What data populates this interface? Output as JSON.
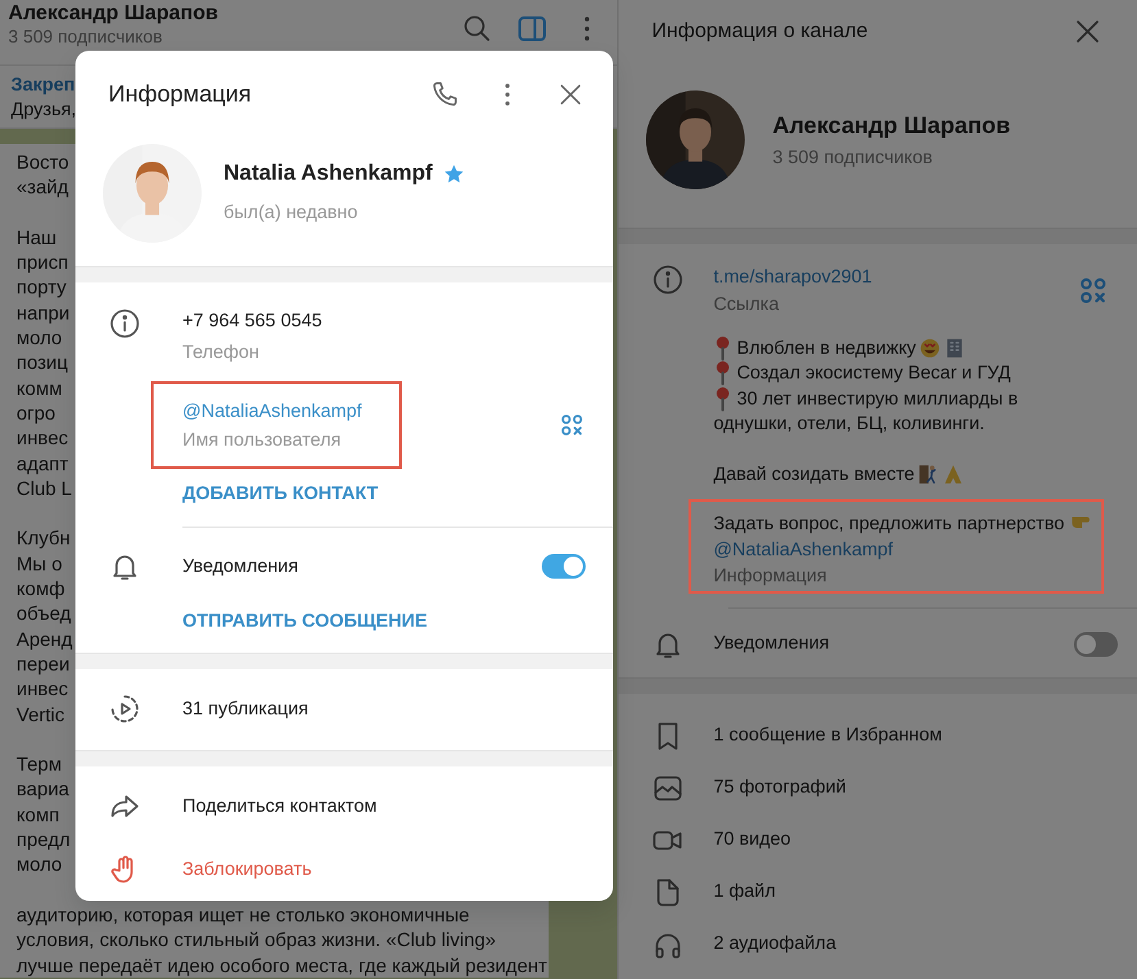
{
  "chat": {
    "title": "Александр Шарапов",
    "subtitle": "3 509 подписчиков",
    "pinned": {
      "label": "Закреп",
      "text": "Друзья,"
    },
    "message_paragraphs": [
      [
        "Восто",
        "«зайд"
      ],
      [
        "Наш",
        "присп",
        "порту",
        "напри",
        "моло",
        "позиц",
        "комм",
        "огро",
        "инвес",
        "адапт",
        "Club L"
      ],
      [
        "Клубн",
        "Мы о",
        "комф",
        "объед",
        "Аренд",
        "переи",
        "инвес",
        "Vertic"
      ],
      [
        "Терм",
        "вариа",
        "комп",
        "предл",
        "моло"
      ],
      [
        "аудиторию, которая ищет не столько экономичные",
        "условия, сколько стильный образ жизни. «Club living»",
        "лучше передаёт идею особого места, где каждый резидент"
      ]
    ]
  },
  "channel_info": {
    "title": "Информация о канале",
    "name": "Александр Шарапов",
    "subscribers": "3 509 подписчиков",
    "link": {
      "value": "t.me/sharapov2901",
      "caption": "Ссылка"
    },
    "description": [
      [
        {
          "pin": true,
          "text": "Влюблен в недвижку"
        },
        {
          "pin": true,
          "text": "Создал экосистему Becar и ГУД"
        },
        {
          "pin": true,
          "text": "30 лет инвестирую миллиарды в"
        },
        {
          "pin": false,
          "text": "однушки, отели, БЦ, коливинги."
        }
      ],
      [
        {
          "pin": false,
          "text": "Давай созидать вместе"
        }
      ]
    ],
    "contact": {
      "text": "Задать вопрос, предложить партнерство",
      "username": "@NataliaAshenkampf",
      "caption": "Информация",
      "highlighted": true
    },
    "notifications": {
      "label": "Уведомления",
      "on": false
    },
    "media": [
      {
        "kind": "bookmark",
        "text": "1 сообщение в Избранном"
      },
      {
        "text": "75 фотографий"
      },
      {
        "kind": "video",
        "text": "70 видео"
      },
      {
        "kind": "file",
        "text": "1 файл"
      },
      {
        "kind": "audio",
        "text": "2 аудиофайла"
      }
    ]
  },
  "dialog": {
    "title": "Информация",
    "name": "Natalia Ashenkampf",
    "verified": true,
    "status": "был(а) недавно",
    "phone": {
      "value": "+7 964 565 0545",
      "caption": "Телефон"
    },
    "username": {
      "value": "@NataliaAshenkampf",
      "caption": "Имя пользователя",
      "highlighted": true
    },
    "add_contact": "ДОБАВИТЬ КОНТАКТ",
    "notifications": {
      "label": "Уведомления",
      "on": true
    },
    "send_message": "ОТПРАВИТЬ СООБЩЕНИЕ",
    "posts": "31 публикация",
    "actions": [
      {
        "kind": "share",
        "label": "Поделиться контактом",
        "danger": false
      },
      {
        "kind": "block",
        "label": "Заблокировать",
        "danger": true
      }
    ]
  }
}
